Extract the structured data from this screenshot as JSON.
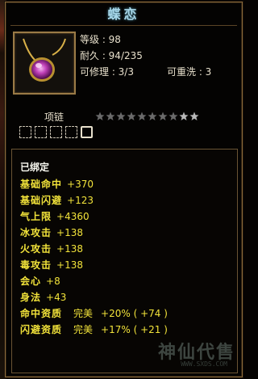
{
  "item": {
    "name": "蝶恋",
    "type_label": "项链",
    "level_text": "等级 : 98",
    "durability_text": "耐久 : 94/235",
    "repairable_text": "可修理 : 3/3",
    "rewashable_text": "可重洗 : 3",
    "stars_filled": 8,
    "stars_total": 10,
    "gem_slots": 5
  },
  "attributes": {
    "bound": "已绑定",
    "lines": [
      {
        "name": "基础命中",
        "value": "+370"
      },
      {
        "name": "基础闪避",
        "value": "+123"
      },
      {
        "name": "气上限",
        "value": "+4360"
      },
      {
        "name": "冰攻击",
        "value": "+138"
      },
      {
        "name": "火攻击",
        "value": "+138"
      },
      {
        "name": "毒攻击",
        "value": "+138"
      },
      {
        "name": "会心",
        "value": "+8"
      },
      {
        "name": "身法",
        "value": "+43"
      }
    ],
    "quality": [
      {
        "name": "命中资质",
        "grade": "完美",
        "value": "+20% ( +74 )"
      },
      {
        "name": "闪避资质",
        "grade": "完美",
        "value": "+17% ( +21 )"
      }
    ]
  },
  "watermark": {
    "text": "神仙代售",
    "url": "WWW.SXDS.COM"
  },
  "colors": {
    "title": "#a8d8ea",
    "attribute": "#f2e33a",
    "text": "#e8e0cc",
    "border": "#8a6a3a"
  }
}
